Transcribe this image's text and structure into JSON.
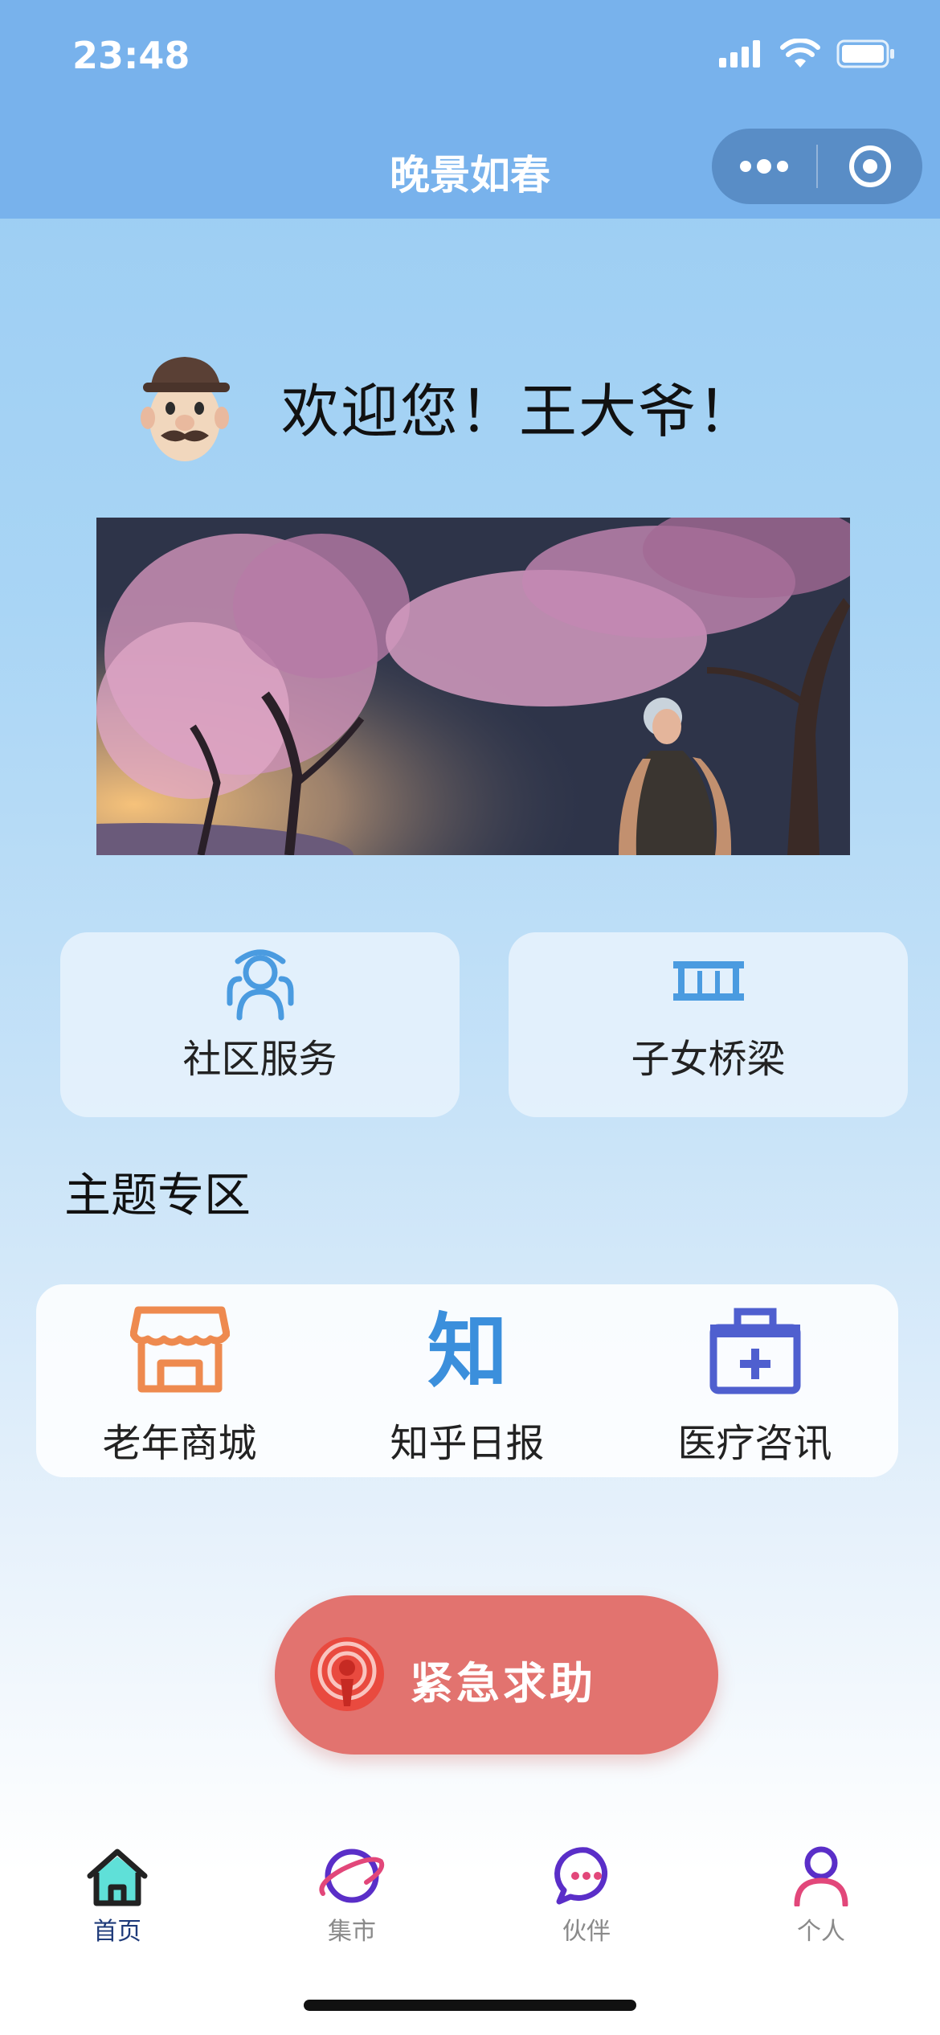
{
  "status_bar": {
    "time": "23:48"
  },
  "nav": {
    "title": "晚景如春"
  },
  "welcome": {
    "text": "欢迎您！王大爷！"
  },
  "services": [
    {
      "label": "社区服务",
      "icon": "community-service-icon"
    },
    {
      "label": "子女桥梁",
      "icon": "bridge-icon"
    }
  ],
  "section": {
    "title": "主题专区"
  },
  "themes": [
    {
      "label": "老年商城",
      "icon": "shop-icon"
    },
    {
      "label": "知乎日报",
      "icon": "zhihu-icon"
    },
    {
      "label": "医疗咨讯",
      "icon": "medical-kit-icon"
    }
  ],
  "sos": {
    "label": "紧急求助",
    "icon": "alert-podcast-icon"
  },
  "tab_bar": {
    "tabs": [
      {
        "label": "首页",
        "icon": "home-icon",
        "active": true
      },
      {
        "label": "集市",
        "icon": "planet-icon",
        "active": false
      },
      {
        "label": "伙伴",
        "icon": "chat-bubble-icon",
        "active": false
      },
      {
        "label": "个人",
        "icon": "person-icon",
        "active": false
      }
    ]
  },
  "colors": {
    "nav_bg": "#78b2ec",
    "sos_bg": "#e2736f",
    "card_icon": "#4a9be0",
    "shop_icon": "#ee8a4f",
    "zhihu_icon": "#3b8fdc",
    "medical_icon": "#4f5fcf",
    "tab_active": "#1f3b7a"
  }
}
